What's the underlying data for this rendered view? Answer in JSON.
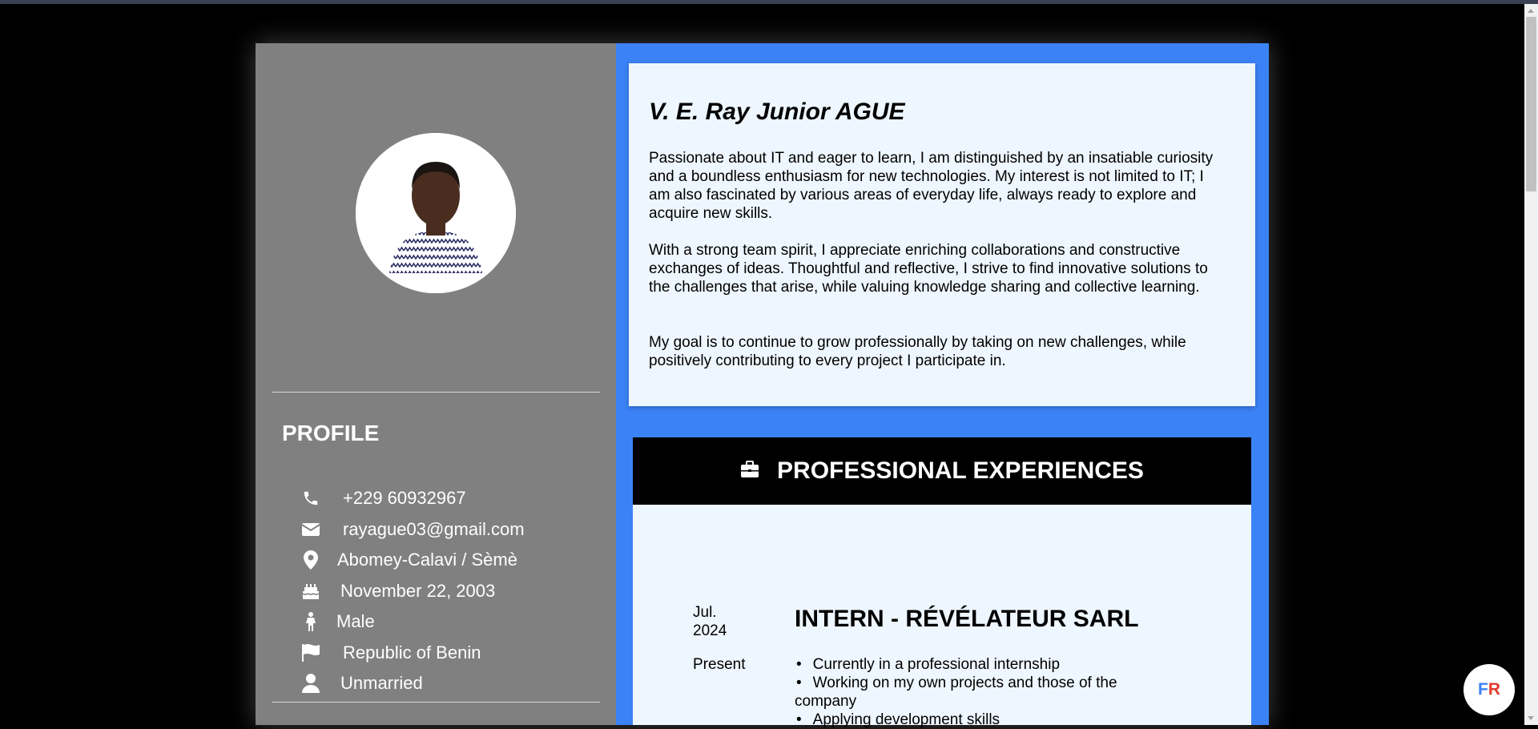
{
  "profile": {
    "heading": "PROFILE",
    "items": [
      {
        "icon": "phone-icon",
        "text": "+229 60932967"
      },
      {
        "icon": "envelope-icon",
        "text": "rayague03@gmail.com"
      },
      {
        "icon": "map-pin-icon",
        "text": "Abomey-Calavi / Sèmè"
      },
      {
        "icon": "birthday-cake-icon",
        "text": "November 22, 2003"
      },
      {
        "icon": "person-icon",
        "text": "Male"
      },
      {
        "icon": "flag-icon",
        "text": "Republic of Benin"
      },
      {
        "icon": "user-icon",
        "text": "Unmarried"
      }
    ]
  },
  "about": {
    "name": "V. E. Ray Junior AGUE",
    "paragraphs": [
      "Passionate about IT and eager to learn, I am distinguished by an insatiable curiosity and a boundless enthusiasm for new technologies. My interest is not limited to IT; I am also fascinated by various areas of everyday life, always ready to explore and acquire new skills.",
      "With a strong team spirit, I appreciate enriching collaborations and constructive exchanges of ideas. Thoughtful and reflective, I strive to find innovative solutions to the challenges that arise, while valuing knowledge sharing and collective learning.",
      "My goal is to continue to grow professionally by taking on new challenges, while positively contributing to every project I participate in."
    ]
  },
  "experiences": {
    "heading": "PROFESSIONAL EXPERIENCES",
    "items": [
      {
        "start": "Jul. 2024",
        "end": "Present",
        "title": "INTERN - RÉVÉLATEUR SARL",
        "bullets": [
          "Currently in a professional internship",
          "Working on my own projects and those of the company",
          "Applying development skills"
        ]
      }
    ]
  },
  "language_toggle": {
    "first": "F",
    "second": "R"
  },
  "colors": {
    "accent": "#3b82f6",
    "sidebar": "#808080",
    "card": "#eef6ff",
    "lang_second": "#e23b2e"
  }
}
